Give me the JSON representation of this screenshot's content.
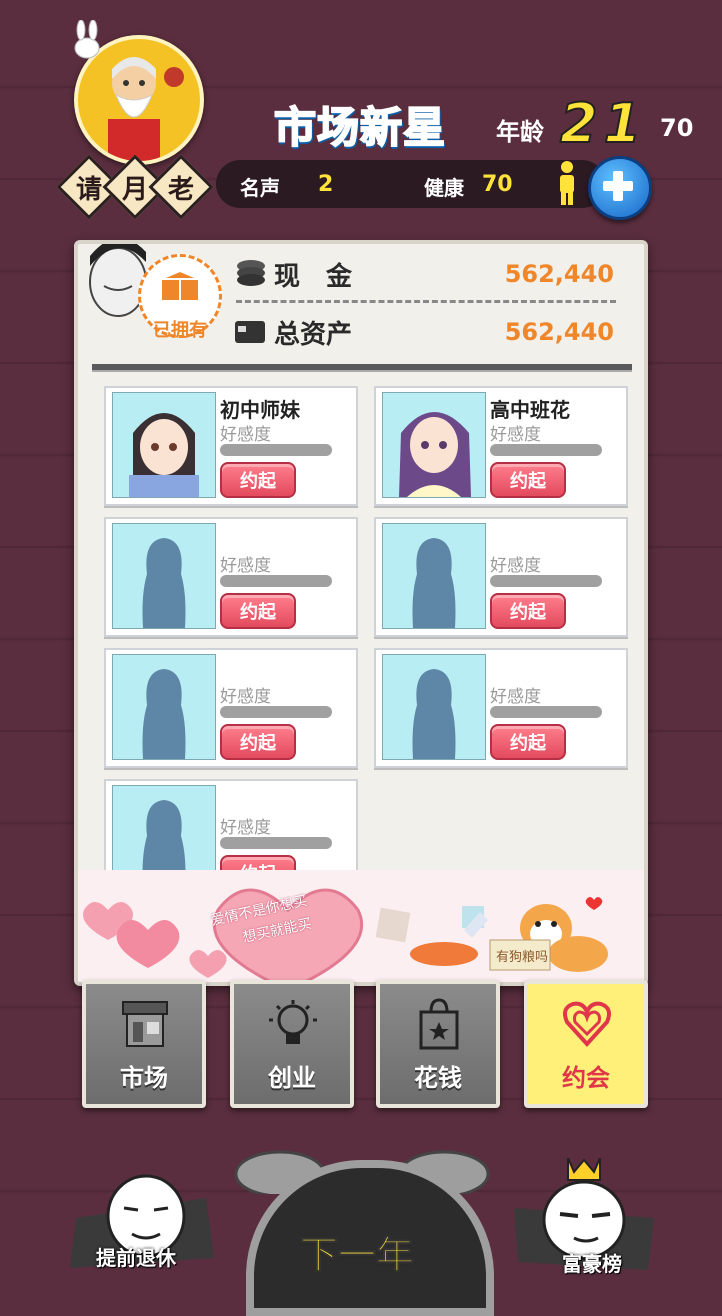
{
  "header": {
    "moon_tag": [
      "请",
      "月",
      "老"
    ],
    "title": "市场新星",
    "age_label": "年龄",
    "age_current": "21",
    "age_total": "70"
  },
  "stats": {
    "fame_label": "名声",
    "fame_value": "2",
    "health_label": "健康",
    "health_value": "70"
  },
  "finance": {
    "owned_badge": "已拥有",
    "cash_label": "现　金",
    "cash_value": "562,440",
    "assets_label": "总资产",
    "assets_value": "562,440"
  },
  "girls": [
    {
      "name": "初中师妹",
      "fav_label": "好感度",
      "button": "约起",
      "affection": 0
    },
    {
      "name": "高中班花",
      "fav_label": "好感度",
      "button": "约起",
      "affection": 0
    },
    {
      "name": "",
      "fav_label": "好感度",
      "button": "约起",
      "affection": 0
    },
    {
      "name": "",
      "fav_label": "好感度",
      "button": "约起",
      "affection": 0
    },
    {
      "name": "",
      "fav_label": "好感度",
      "button": "约起",
      "affection": 0
    },
    {
      "name": "",
      "fav_label": "好感度",
      "button": "约起",
      "affection": 0
    },
    {
      "name": "",
      "fav_label": "好感度",
      "button": "约起",
      "affection": 0
    }
  ],
  "banner": {
    "heart_text_line1": "爱情不是你想买",
    "heart_text_line2": "想买就能买",
    "dog_sign": "有狗粮吗"
  },
  "tabs": [
    {
      "label": "市场",
      "icon": "shop-icon",
      "active": false
    },
    {
      "label": "创业",
      "icon": "lightbulb-icon",
      "active": false
    },
    {
      "label": "花钱",
      "icon": "shopping-bag-icon",
      "active": false
    },
    {
      "label": "约会",
      "icon": "heart-icon",
      "active": true
    }
  ],
  "bottom": {
    "retire_label": "提前退休",
    "next_year_label": "下一年",
    "rich_list_label": "富豪榜"
  },
  "colors": {
    "accent_orange": "#f0862a",
    "accent_yellow": "#ffe23a",
    "date_button_red": "#e34a5e",
    "title_blue": "#2aa6ff"
  }
}
